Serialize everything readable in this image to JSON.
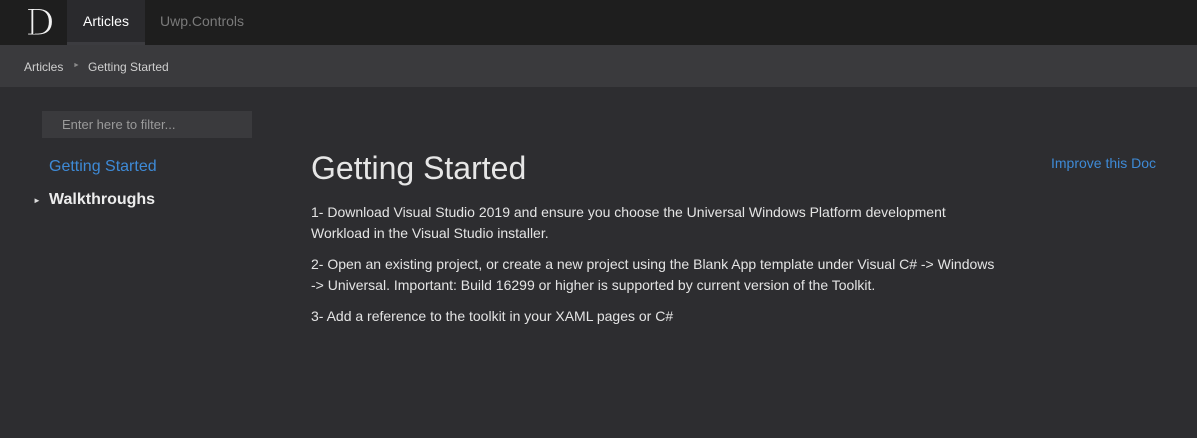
{
  "header": {
    "logo_letter": "D",
    "tabs": [
      {
        "label": "Articles"
      },
      {
        "label": "Uwp.Controls"
      }
    ]
  },
  "breadcrumb": {
    "items": [
      "Articles",
      "Getting Started"
    ],
    "separator": "►"
  },
  "sidebar": {
    "filter_placeholder": "Enter here to filter...",
    "items": [
      {
        "label": "Getting Started"
      },
      {
        "label": "Walkthroughs",
        "expander": "►"
      }
    ]
  },
  "main": {
    "title": "Getting Started",
    "improve_link": "Improve this Doc",
    "paragraphs": [
      "1- Download Visual Studio 2019 and ensure you choose the Universal Windows Platform development Workload in the Visual Studio installer.",
      "2- Open an existing project, or create a new project using the Blank App template under Visual C# -> Windows -> Universal. Important: Build 16299 or higher is supported by current version of the Toolkit.",
      "3- Add a reference to the toolkit in your XAML pages or C#"
    ]
  },
  "colors": {
    "link": "#3e8ad6",
    "topbar": "#1e1e1e",
    "breadcrumb_bar": "#3a3a3d",
    "background": "#2d2d30"
  }
}
